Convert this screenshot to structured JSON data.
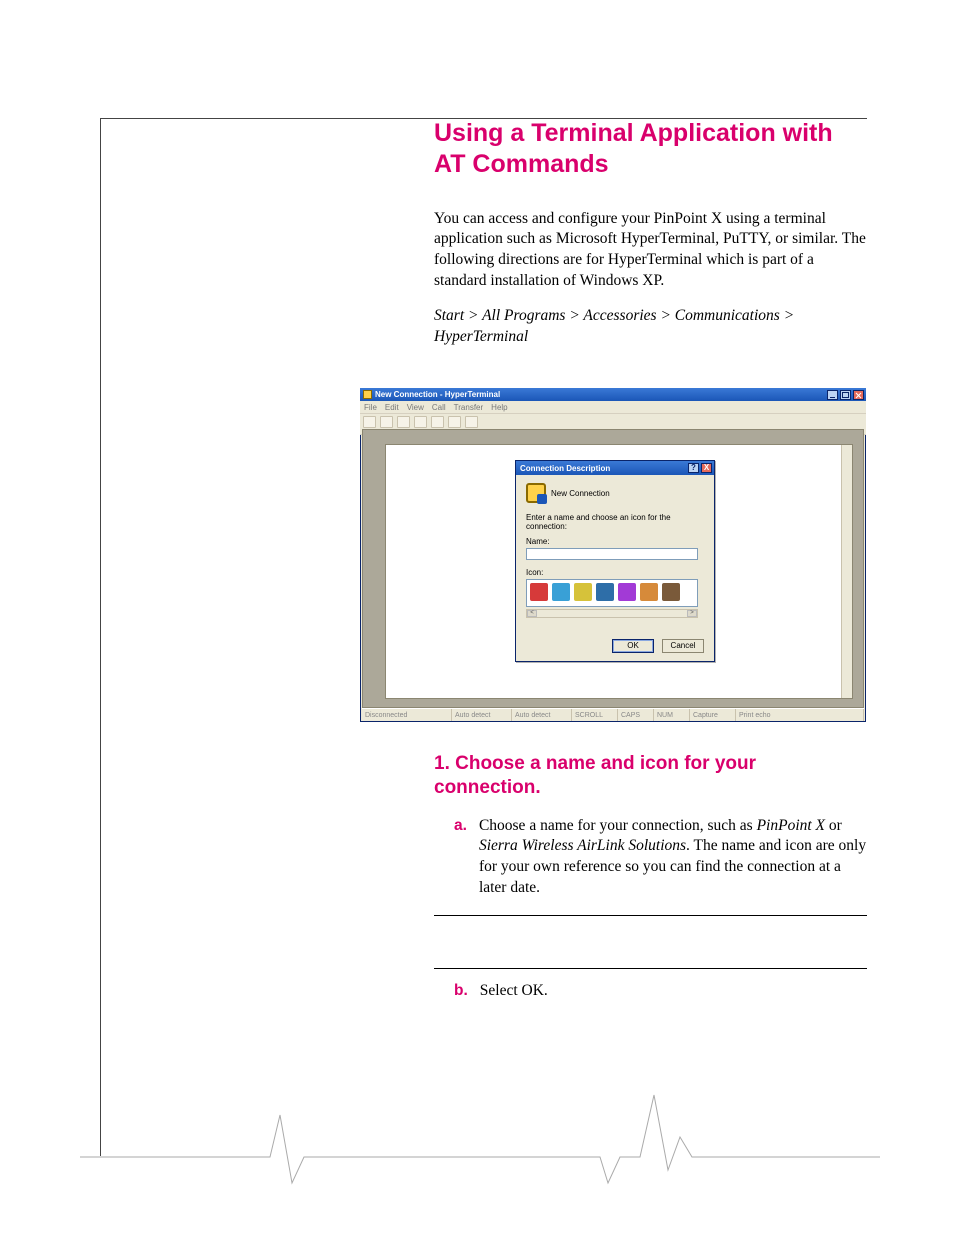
{
  "page": {
    "title": "Using a Terminal Application with AT Commands",
    "intro": "You can access and configure your PinPoint X using a terminal application such as Microsoft HyperTerminal, PuTTY, or similar. The following directions are for HyperTerminal which is part of a standard installation of Windows XP.",
    "path": "Start > All Programs > Accessories > Communications > HyperTerminal",
    "section1_title": "1. Choose a name and icon for your connection.",
    "step_a_marker": "a.",
    "step_a_prefix": "Choose a name for your connection, such as ",
    "step_a_em1": "PinPoint X",
    "step_a_mid": " or ",
    "step_a_em2": "Sierra Wireless AirLink Solutions",
    "step_a_suffix": ". The name and icon are only for your own reference so you can find the connection at a later date.",
    "step_b_marker": "b.",
    "step_b_text": "Select OK."
  },
  "hyperterminal": {
    "window_title": "New Connection - HyperTerminal",
    "menu": {
      "file": "File",
      "edit": "Edit",
      "view": "View",
      "call": "Call",
      "transfer": "Transfer",
      "help": "Help"
    },
    "status": {
      "conn": "Disconnected",
      "detect1": "Auto detect",
      "detect2": "Auto detect",
      "scroll": "SCROLL",
      "caps": "CAPS",
      "num": "NUM",
      "capture": "Capture",
      "echo": "Print echo"
    },
    "dialog": {
      "title": "Connection Description",
      "heading": "New Connection",
      "prompt": "Enter a name and choose an icon for the connection:",
      "name_label": "Name:",
      "name_value": "",
      "icon_label": "Icon:",
      "help": "?",
      "close": "X",
      "ok": "OK",
      "cancel": "Cancel",
      "scroll_left": "<",
      "scroll_right": ">",
      "icon_colors": [
        "#d63a3a",
        "#39a0d6",
        "#d6c23a",
        "#2e6ea8",
        "#a23ad6",
        "#d68a3a",
        "#7a5a3a"
      ]
    }
  }
}
